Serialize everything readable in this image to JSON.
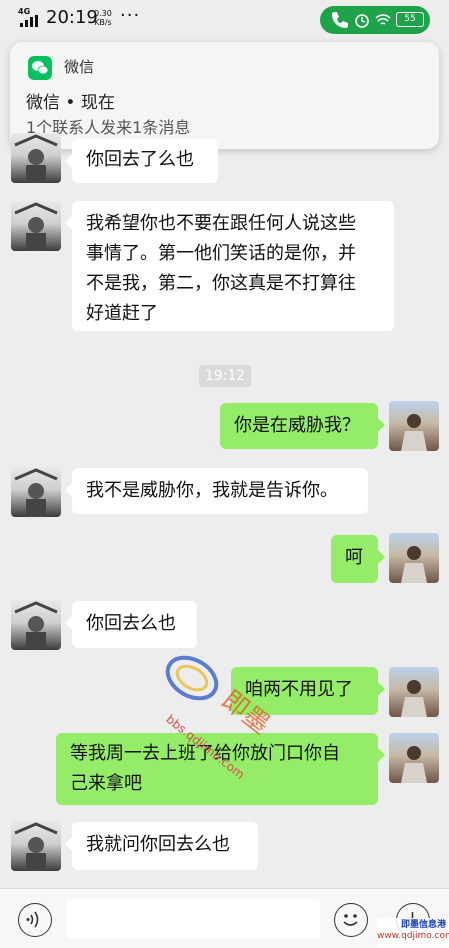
{
  "status_bar": {
    "network": "4G",
    "time": "20:19",
    "speed_value": "0.30",
    "speed_unit": "KB/s",
    "more": "···",
    "battery": "55",
    "call_pill_color": "#1fa34a"
  },
  "notification": {
    "app_name": "微信",
    "title": "微信 • 现在",
    "body": "1个联系人发来1条消息",
    "icon": "wechat-icon"
  },
  "messages": [
    {
      "side": "left",
      "text": "你回去了么也"
    },
    {
      "side": "left",
      "lines": [
        "我希望你也不要在跟任何人说这些",
        "事情了。第一他们笑话的是你，并",
        "不是我，第二，你这真是不打算往",
        "好道赶了"
      ]
    },
    {
      "side": "right",
      "text": "你是在威胁我？"
    },
    {
      "side": "left",
      "text": "我不是威胁你，我就是告诉你。"
    },
    {
      "side": "right",
      "text": "呵"
    },
    {
      "side": "left",
      "text": "你回去么也"
    },
    {
      "side": "right",
      "text": "咱两不用见了"
    },
    {
      "side": "right",
      "lines": [
        "等我周一去上班了给你放门口你自",
        "己来拿吧"
      ]
    },
    {
      "side": "left",
      "text": "我就问你回去么也"
    }
  ],
  "timestamp": "19:12",
  "watermark": {
    "url": "bbs.qdjimo.com",
    "corner_site": "www.qdjimo.com",
    "corner_name": "即墨信息港"
  },
  "colors": {
    "background": "#ededed",
    "bubble_self": "#95ec69",
    "bubble_other": "#ffffff"
  },
  "input_bar": {
    "voice_icon": "voice-icon",
    "emoji_icon": "emoji-icon",
    "plus_icon": "plus-icon"
  }
}
